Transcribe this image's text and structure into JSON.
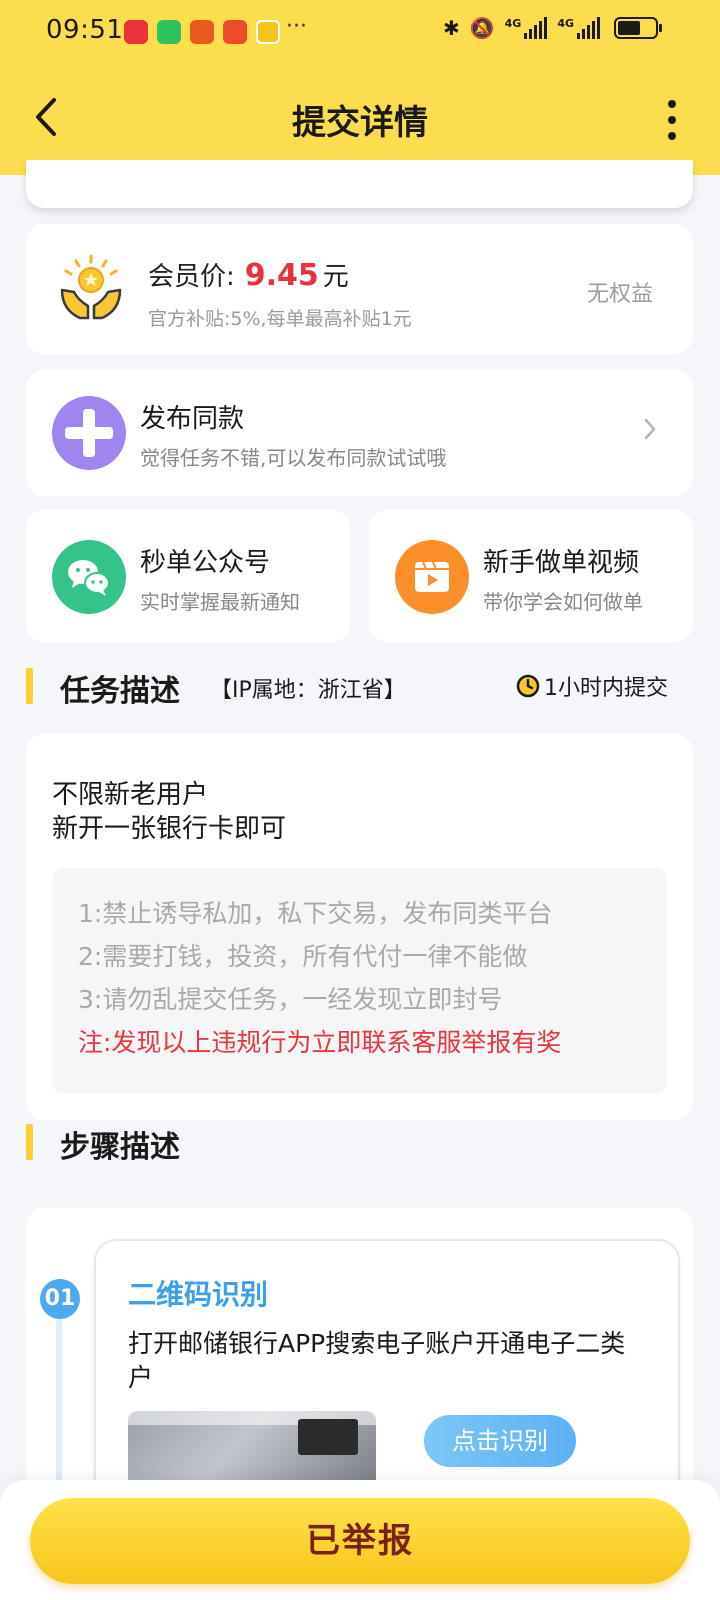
{
  "status_bar": {
    "time": "09:51",
    "more_indicator": "···",
    "notification_icons": [
      "app-icon-red",
      "wechat-icon",
      "game-icon",
      "shopping-icon",
      "video-icon"
    ],
    "network_label": "4G",
    "battery_percent": 60
  },
  "header": {
    "title": "提交详情",
    "back_icon": "chevron-left-icon",
    "menu_icon": "more-vertical-icon"
  },
  "price_card": {
    "label": "会员价:",
    "value": "9.45",
    "unit": "元",
    "subsidy": "官方补贴:5%,每单最高补贴1元",
    "right_text": "无权益"
  },
  "publish_card": {
    "title": "发布同款",
    "subtitle": "觉得任务不错,可以发布同款试试哦"
  },
  "wechat_card": {
    "title": "秒单公众号",
    "subtitle": "实时掌握最新通知"
  },
  "video_card": {
    "title": "新手做单视频",
    "subtitle": "带你学会如何做单"
  },
  "task_section": {
    "title": "任务描述",
    "ip_location": "【IP属地：浙江省】",
    "deadline": "1小时内提交",
    "main_lines": [
      "不限新老用户",
      "新开一张银行卡即可"
    ],
    "rules": [
      "1:禁止诱导私加，私下交易，发布同类平台",
      "2:需要打钱，投资，所有代付一律不能做",
      "3:请勿乱提交任务，一经发现立即封号"
    ],
    "warning": "注:发现以上违规行为立即联系客服举报有奖"
  },
  "steps_section": {
    "title": "步骤描述",
    "steps": [
      {
        "number": "01",
        "title": "二维码识别",
        "description": "打开邮储银行APP搜索电子账户开通电子二类户",
        "action_label": "点击识别"
      }
    ]
  },
  "bottom": {
    "button_label": "已举报"
  },
  "colors": {
    "header_bg": "#fbdd4e",
    "price_red": "#e8323a",
    "step_blue": "#3aa0ec",
    "warning_red": "#e8363d",
    "button_yellow": "#f8c51c"
  }
}
